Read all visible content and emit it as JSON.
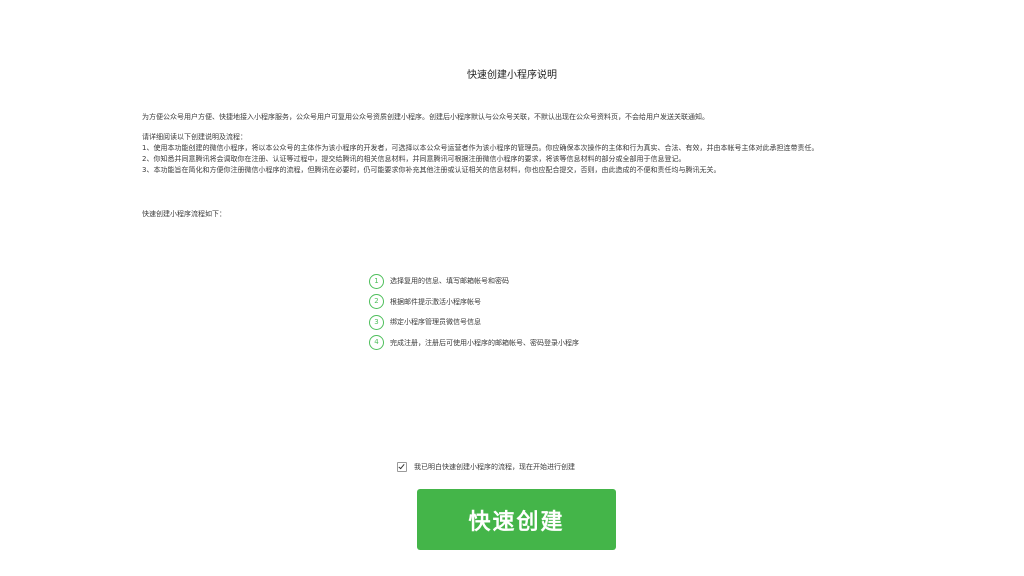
{
  "page": {
    "title": "快速创建小程序说明",
    "intro": "为方便公众号用户方便、快捷地接入小程序服务，公众号用户可复用公众号资质创建小程序。创建后小程序默认与公众号关联，不默认出现在公众号资料页，不会给用户发送关联通知。",
    "rules_heading": "请详细阅读以下创建说明及流程：",
    "rules": [
      "1、使用本功能创建的微信小程序，将以本公众号的主体作为该小程序的开发者，可选择以本公众号运营者作为该小程序的管理员。你应确保本次操作的主体和行为真实、合法、有效，并由本帐号主体对此承担连带责任。",
      "2、你知悉并同意腾讯将会调取你在注册、认证等过程中，提交给腾讯的相关信息材料，并同意腾讯可根据注册微信小程序的要求，将该等信息材料的部分或全部用于信息登记。",
      "3、本功能旨在简化和方便你注册微信小程序的流程，但腾讯在必要时，仍可能要求你补充其他注册或认证相关的信息材料，你也应配合提交，否则，由此造成的不便和责任均与腾讯无关。"
    ],
    "flow_heading": "快速创建小程序流程如下：",
    "steps": [
      {
        "num": "1",
        "text": "选择复用的信息、填写邮箱帐号和密码"
      },
      {
        "num": "2",
        "text": "根据邮件提示激活小程序帐号"
      },
      {
        "num": "3",
        "text": "绑定小程序管理员微信号信息"
      },
      {
        "num": "4",
        "text": "完成注册，注册后可使用小程序的邮箱帐号、密码登录小程序"
      }
    ],
    "agree_label": "我已明白快速创建小程序的流程，现在开始进行创建",
    "agree_checked": true,
    "create_button": "快速创建"
  },
  "colors": {
    "accent": "#44b549",
    "step_circle": "#4fbf5c",
    "text": "#3a3a3a"
  }
}
